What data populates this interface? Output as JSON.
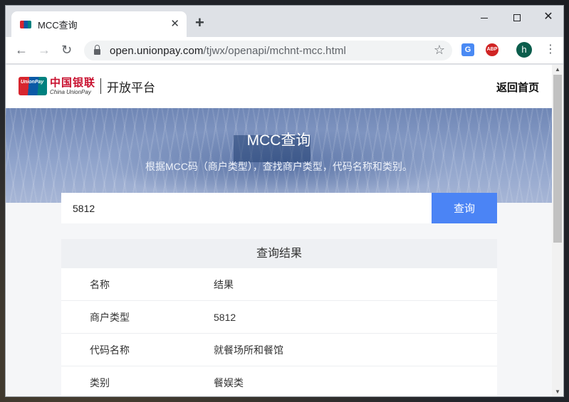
{
  "browser": {
    "tab_title": "MCC查询",
    "tab_close": "✕",
    "new_tab": "+",
    "url_host": "open.unionpay.com",
    "url_path": "/tjwx/openapi/mchnt-mcc.html",
    "profile_initial": "h",
    "extension_abp": "ABP",
    "extension_translate": "G",
    "window_close": "✕",
    "icons": {
      "back": "back-arrow-icon",
      "forward": "forward-arrow-icon",
      "reload": "reload-icon",
      "lock": "lock-icon",
      "star": "star-icon",
      "menu": "kebab-menu-icon"
    }
  },
  "site": {
    "brand_cn": "中国银联",
    "brand_en": "China UnionPay",
    "brand_mark": "UnionPay",
    "platform": "开放平台",
    "home_link": "返回首页"
  },
  "hero": {
    "title": "MCC查询",
    "subtitle": "根据MCC码（商户类型），查找商户类型，代码名称和类别。"
  },
  "search": {
    "value": "5812",
    "button_label": "查询"
  },
  "results": {
    "heading": "查询结果",
    "rows": [
      {
        "key": "名称",
        "value": "结果"
      },
      {
        "key": "商户类型",
        "value": "5812"
      },
      {
        "key": "代码名称",
        "value": "就餐场所和餐馆"
      },
      {
        "key": "类别",
        "value": "餐娱类"
      }
    ]
  },
  "colors": {
    "accent": "#4b84f5",
    "brand_red": "#d7262f",
    "brand_blue": "#0b5aa6",
    "brand_teal": "#00817f"
  }
}
